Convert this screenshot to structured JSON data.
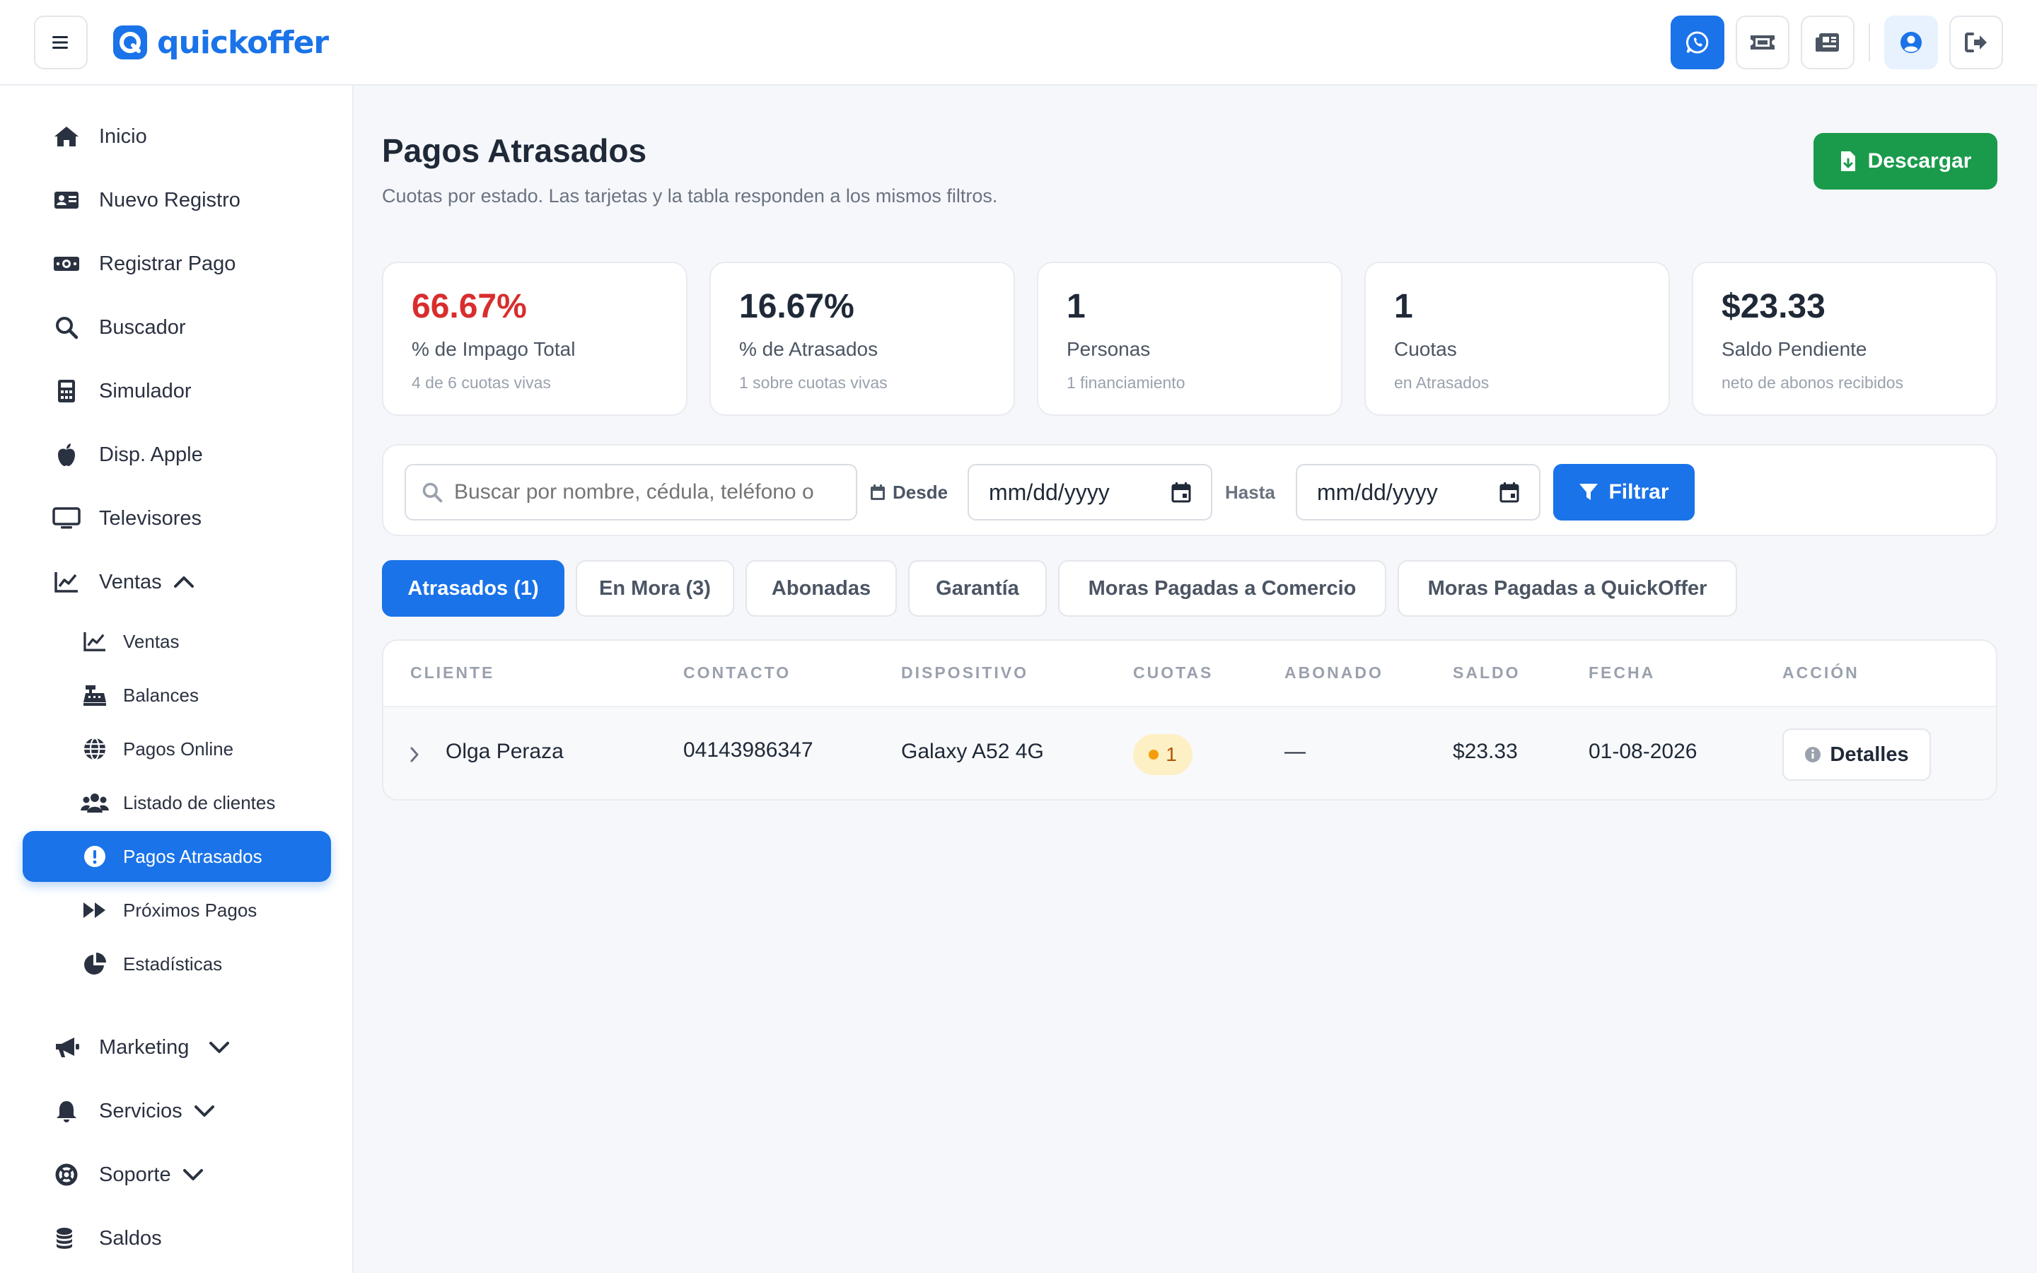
{
  "header": {
    "brand": "quickoffer",
    "actions": [
      {
        "icon": "whatsapp-icon"
      },
      {
        "icon": "ticket-icon"
      },
      {
        "icon": "newspaper-icon"
      },
      {
        "icon": "user-circle-icon"
      },
      {
        "icon": "logout-icon"
      }
    ]
  },
  "sidebar": {
    "items": [
      {
        "label": "Inicio",
        "icon": "home-icon"
      },
      {
        "label": "Nuevo Registro",
        "icon": "id-card-icon"
      },
      {
        "label": "Registrar Pago",
        "icon": "money-icon"
      },
      {
        "label": "Buscador",
        "icon": "search-icon"
      },
      {
        "label": "Simulador",
        "icon": "calculator-icon"
      },
      {
        "label": "Disp. Apple",
        "icon": "apple-icon"
      },
      {
        "label": "Televisores",
        "icon": "tv-icon"
      },
      {
        "label": "Ventas",
        "icon": "chart-line-icon",
        "expanded": true
      }
    ],
    "ventas_sub": [
      {
        "label": "Ventas",
        "icon": "chart-line-icon"
      },
      {
        "label": "Balances",
        "icon": "cash-register-icon"
      },
      {
        "label": "Pagos Online",
        "icon": "globe-icon"
      },
      {
        "label": "Listado de clientes",
        "icon": "users-icon"
      },
      {
        "label": "Pagos Atrasados",
        "icon": "alert-circle-icon",
        "active": true
      },
      {
        "label": "Próximos Pagos",
        "icon": "fast-forward-icon"
      },
      {
        "label": "Estadísticas",
        "icon": "pie-chart-icon"
      }
    ],
    "bottom_items": [
      {
        "label": "Marketing",
        "icon": "megaphone-icon"
      },
      {
        "label": "Servicios",
        "icon": "bell-icon"
      },
      {
        "label": "Soporte",
        "icon": "lifebuoy-icon"
      },
      {
        "label": "Saldos",
        "icon": "coins-icon"
      }
    ]
  },
  "page": {
    "title": "Pagos Atrasados",
    "subtitle": "Cuotas por estado. Las tarjetas y la tabla responden a los mismos filtros.",
    "download_label": "Descargar"
  },
  "cards": [
    {
      "value": "66.67%",
      "label": "% de Impago Total",
      "sub": "4 de 6 cuotas vivas",
      "color": "#d92d2d"
    },
    {
      "value": "16.67%",
      "label": "% de Atrasados",
      "sub": "1 sobre cuotas vivas"
    },
    {
      "value": "1",
      "label": "Personas",
      "sub": "1 financiamiento"
    },
    {
      "value": "1",
      "label": "Cuotas",
      "sub": "en Atrasados"
    },
    {
      "value": "$23.33",
      "label": "Saldo Pendiente",
      "sub": "neto de abonos recibidos"
    }
  ],
  "filters": {
    "search_placeholder": "Buscar por nombre, cédula, teléfono o",
    "from_label": "Desde",
    "to_label": "Hasta",
    "date_placeholder": "mm/dd/yyyy",
    "filter_label": "Filtrar"
  },
  "tabs": [
    {
      "label": "Atrasados (1)",
      "active": true
    },
    {
      "label": "En Mora (3)"
    },
    {
      "label": "Abonadas"
    },
    {
      "label": "Garantía"
    },
    {
      "label": "Moras Pagadas a Comercio"
    },
    {
      "label": "Moras Pagadas a QuickOffer"
    }
  ],
  "table": {
    "columns": [
      "CLIENTE",
      "CONTACTO",
      "DISPOSITIVO",
      "CUOTAS",
      "ABONADO",
      "SALDO",
      "FECHA",
      "ACCIÓN"
    ],
    "rows": [
      {
        "cliente": "Olga Peraza",
        "contacto": "04143986347",
        "dispositivo": "Galaxy A52 4G",
        "cuotas": "1",
        "abonado": "—",
        "saldo": "$23.33",
        "fecha": "01-08-2026",
        "accion": "Detalles"
      }
    ]
  },
  "colors": {
    "primary": "#1a73e8",
    "success": "#1a9b4b",
    "danger": "#d92d2d",
    "badge_bg": "#fdf0c4"
  }
}
